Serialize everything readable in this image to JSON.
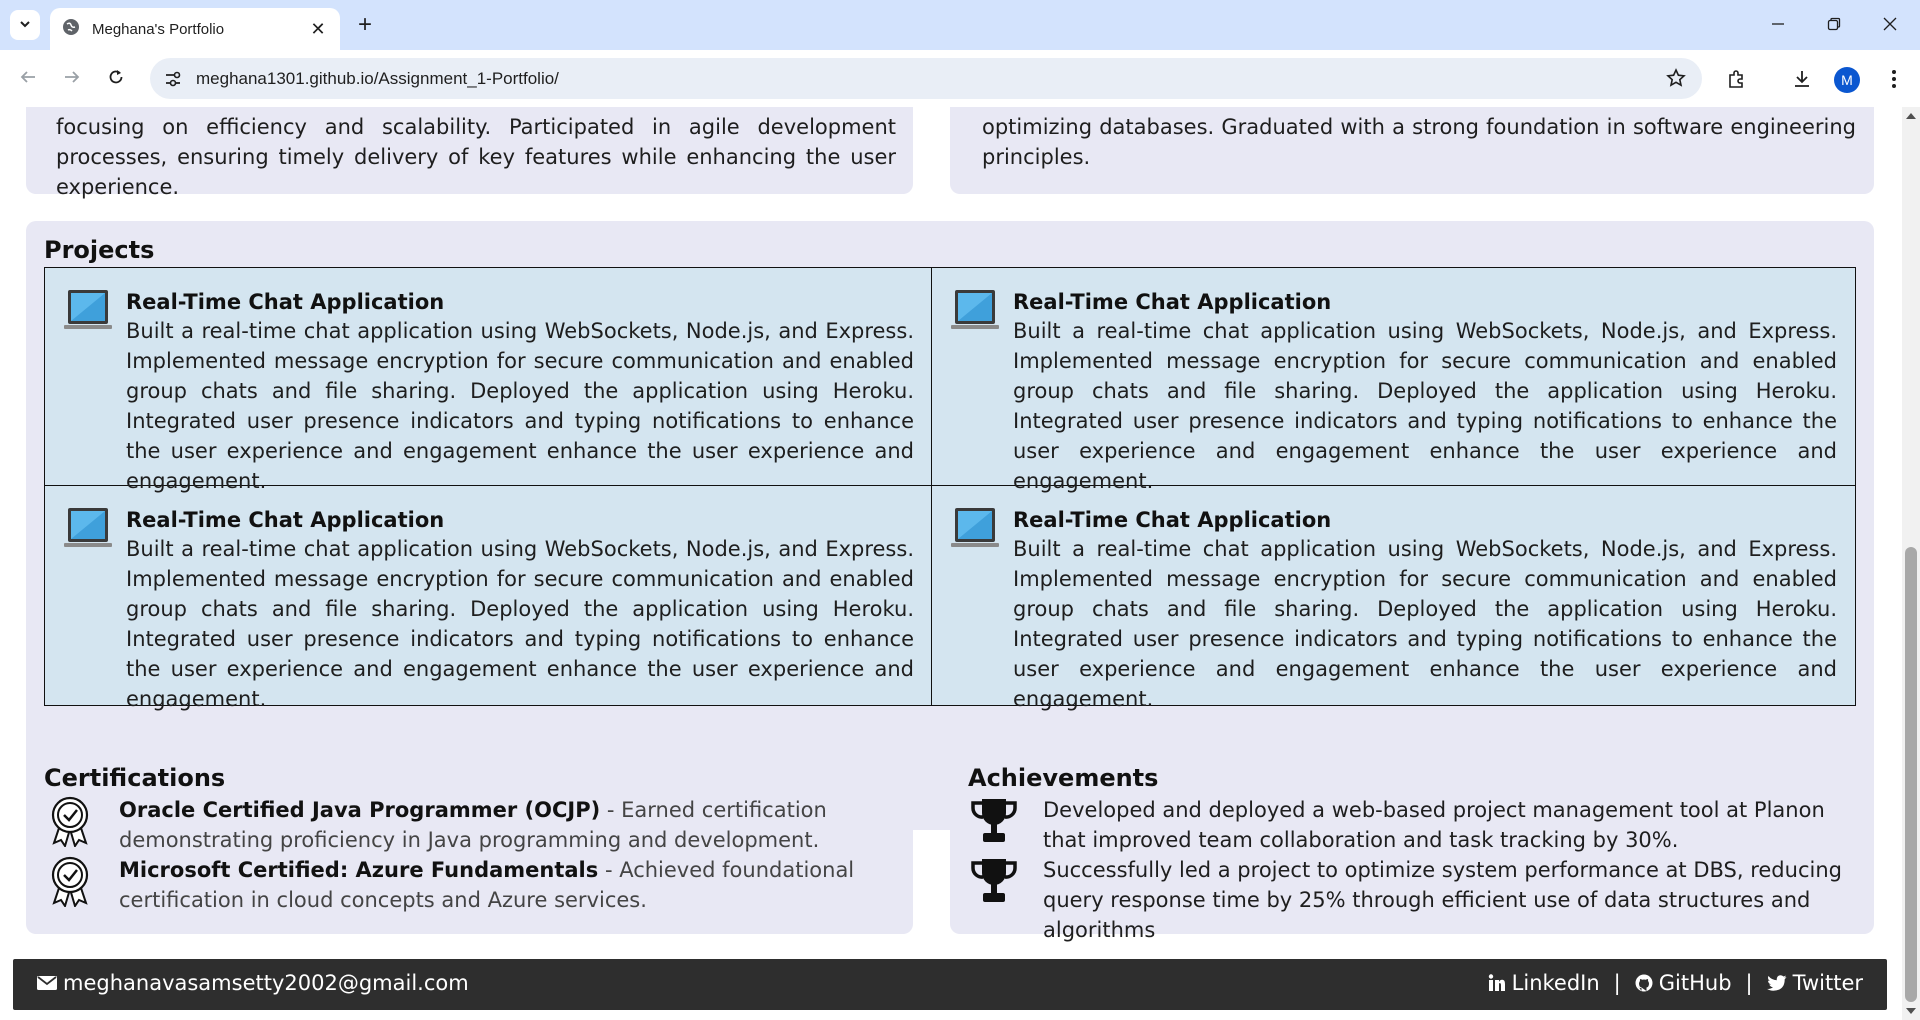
{
  "browser": {
    "tab_title": "Meghana's Portfolio",
    "new_tab_symbol": "+",
    "close_symbol": "✕",
    "url": "meghana1301.github.io/Assignment_1-Portfolio/",
    "profile_initial": "M"
  },
  "experience": {
    "left_text": "focusing on efficiency and scalability. Participated in agile development processes, ensuring timely delivery of key features while enhancing the user experience.",
    "right_text": "optimizing databases. Graduated with a strong foundation in software engineering principles."
  },
  "projects": {
    "title": "Projects",
    "items": [
      {
        "title": "Real-Time Chat Application",
        "description": "Built a real-time chat application using WebSockets, Node.js, and Express. Implemented message encryption for secure communication and enabled group chats and file sharing. Deployed the application using Heroku. Integrated user presence indicators and typing notifications to enhance the user experience and engagement enhance the user experience and engagement.",
        "icon": "laptop-icon"
      },
      {
        "title": "Real-Time Chat Application",
        "description": "Built a real-time chat application using WebSockets, Node.js, and Express. Implemented message encryption for secure communication and enabled group chats and file sharing. Deployed the application using Heroku. Integrated user presence indicators and typing notifications to enhance the user experience and engagement enhance the user experience and engagement.",
        "icon": "laptop-icon"
      },
      {
        "title": "Real-Time Chat Application",
        "description": "Built a real-time chat application using WebSockets, Node.js, and Express. Implemented message encryption for secure communication and enabled group chats and file sharing. Deployed the application using Heroku. Integrated user presence indicators and typing notifications to enhance the user experience and engagement enhance the user experience and engagement.",
        "icon": "laptop-icon"
      },
      {
        "title": "Real-Time Chat Application",
        "description": "Built a real-time chat application using WebSockets, Node.js, and Express. Implemented message encryption for secure communication and enabled group chats and file sharing. Deployed the application using Heroku. Integrated user presence indicators and typing notifications to enhance the user experience and engagement enhance the user experience and engagement.",
        "icon": "laptop-icon"
      }
    ]
  },
  "certifications": {
    "title": "Certifications",
    "items": [
      {
        "name": "Oracle Certified Java Programmer (OCJP)",
        "description": " - Earned certification demonstrating proficiency in Java programming and development.",
        "icon": "certificate-badge-icon"
      },
      {
        "name": "Microsoft Certified: Azure Fundamentals",
        "description": " - Achieved foundational certification in cloud concepts and Azure services.",
        "icon": "certificate-badge-icon"
      }
    ]
  },
  "achievements": {
    "title": "Achievements",
    "items": [
      {
        "text": "Developed and deployed a web-based project management tool at Planon that improved team collaboration and task tracking by 30%.",
        "icon": "trophy-icon"
      },
      {
        "text": "Successfully led a project to optimize system performance at DBS, reducing query response time by 25% through efficient use of data structures and algorithms",
        "icon": "trophy-icon"
      }
    ]
  },
  "footer": {
    "email": "meghanavasamsetty2002@gmail.com",
    "linkedin": "LinkedIn",
    "github": "GitHub",
    "twitter": "Twitter",
    "separator": "|"
  },
  "colors": {
    "tabbar_bg": "#d3e3fd",
    "card_bg": "#e8e8f4",
    "project_grid_bg": "#d4e5f0",
    "footer_bg": "#2e2e2e",
    "profile_avatar": "#0b57d0"
  }
}
